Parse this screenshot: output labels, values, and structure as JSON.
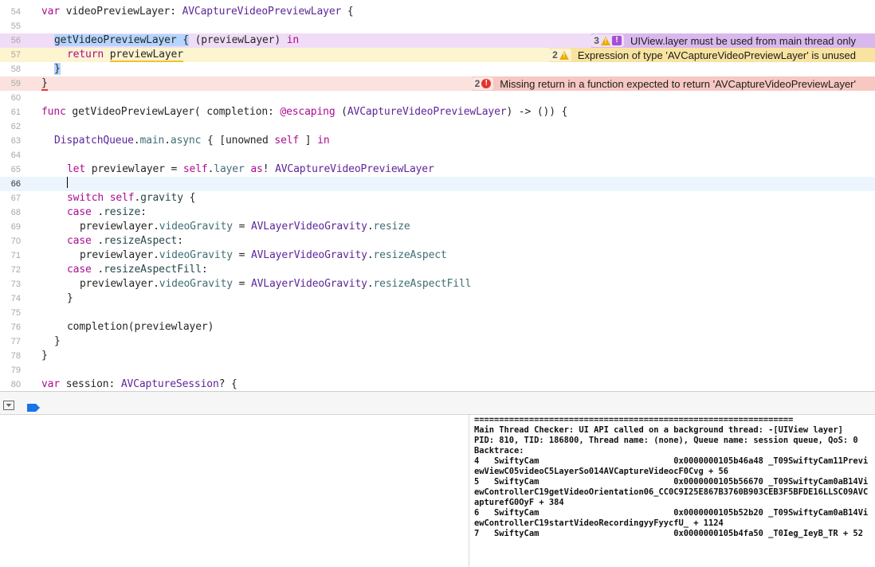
{
  "editor": {
    "lines": [
      {
        "n": "54",
        "segments": [
          [
            "kw",
            "var"
          ],
          [
            "",
            " videoPreviewLayer: "
          ],
          [
            "ty",
            "AVCaptureVideoPreviewLayer"
          ],
          [
            "",
            " {"
          ]
        ]
      },
      {
        "n": "55",
        "segments": []
      },
      {
        "n": "56",
        "segments": [
          [
            "sel",
            "getVideoPreviewLayer {"
          ],
          [
            "",
            " (previewLayer) "
          ],
          [
            "kw",
            "in"
          ]
        ]
      },
      {
        "n": "57",
        "segments": [
          [
            "kw",
            "return"
          ],
          [
            "",
            " "
          ],
          [
            "uw",
            "previewLayer"
          ]
        ]
      },
      {
        "n": "58",
        "segments": [
          [
            "sel",
            "}"
          ]
        ]
      },
      {
        "n": "59",
        "segments": [
          [
            "err",
            "}"
          ]
        ]
      },
      {
        "n": "60",
        "segments": []
      },
      {
        "n": "61",
        "segments": [
          [
            "kw",
            "func"
          ],
          [
            "",
            " getVideoPreviewLayer( completion: "
          ],
          [
            "at",
            "@escaping"
          ],
          [
            "",
            " ("
          ],
          [
            "ty",
            "AVCaptureVideoPreviewLayer"
          ],
          [
            "",
            ") -> ()) {"
          ]
        ]
      },
      {
        "n": "62",
        "segments": []
      },
      {
        "n": "63",
        "segments": [
          [
            "ty",
            "DispatchQueue"
          ],
          [
            "",
            "."
          ],
          [
            "pr",
            "main"
          ],
          [
            "",
            "."
          ],
          [
            "pr",
            "async"
          ],
          [
            "",
            " { [unowned "
          ],
          [
            "kw",
            "self"
          ],
          [
            "",
            " ] "
          ],
          [
            "kw",
            "in"
          ]
        ]
      },
      {
        "n": "64",
        "segments": []
      },
      {
        "n": "65",
        "segments": [
          [
            "kw",
            "let"
          ],
          [
            "",
            " previewlayer = "
          ],
          [
            "kw",
            "self"
          ],
          [
            "",
            "."
          ],
          [
            "pr",
            "layer"
          ],
          [
            "",
            " "
          ],
          [
            "kw",
            "as"
          ],
          [
            "",
            "! "
          ],
          [
            "ty",
            "AVCaptureVideoPreviewLayer"
          ]
        ]
      },
      {
        "n": "66",
        "segments": []
      },
      {
        "n": "67",
        "segments": [
          [
            "kw",
            "switch"
          ],
          [
            "",
            " "
          ],
          [
            "kw",
            "self"
          ],
          [
            "",
            "."
          ],
          [
            "pl",
            "gravity"
          ],
          [
            "",
            " {"
          ]
        ]
      },
      {
        "n": "68",
        "segments": [
          [
            "kw",
            "case"
          ],
          [
            "",
            " ."
          ],
          [
            "pl",
            "resize"
          ],
          [
            "",
            ":"
          ]
        ]
      },
      {
        "n": "69",
        "segments": [
          [
            "",
            "previewlayer."
          ],
          [
            "pr",
            "videoGravity"
          ],
          [
            "",
            " = "
          ],
          [
            "ty",
            "AVLayerVideoGravity"
          ],
          [
            "",
            "."
          ],
          [
            "pr",
            "resize"
          ]
        ]
      },
      {
        "n": "70",
        "segments": [
          [
            "kw",
            "case"
          ],
          [
            "",
            " ."
          ],
          [
            "pl",
            "resizeAspect"
          ],
          [
            "",
            ":"
          ]
        ]
      },
      {
        "n": "71",
        "segments": [
          [
            "",
            "previewlayer."
          ],
          [
            "pr",
            "videoGravity"
          ],
          [
            "",
            " = "
          ],
          [
            "ty",
            "AVLayerVideoGravity"
          ],
          [
            "",
            "."
          ],
          [
            "pr",
            "resizeAspect"
          ]
        ]
      },
      {
        "n": "72",
        "segments": [
          [
            "kw",
            "case"
          ],
          [
            "",
            " ."
          ],
          [
            "pl",
            "resizeAspectFill"
          ],
          [
            "",
            ":"
          ]
        ]
      },
      {
        "n": "73",
        "segments": [
          [
            "",
            "previewlayer."
          ],
          [
            "pr",
            "videoGravity"
          ],
          [
            "",
            " = "
          ],
          [
            "ty",
            "AVLayerVideoGravity"
          ],
          [
            "",
            "."
          ],
          [
            "pr",
            "resizeAspectFill"
          ]
        ]
      },
      {
        "n": "74",
        "segments": [
          [
            "",
            "}"
          ]
        ]
      },
      {
        "n": "75",
        "segments": []
      },
      {
        "n": "76",
        "segments": [
          [
            "",
            "completion(previewlayer)"
          ]
        ]
      },
      {
        "n": "77",
        "segments": [
          [
            "",
            "}"
          ]
        ]
      },
      {
        "n": "78",
        "segments": [
          [
            "",
            "}"
          ]
        ]
      },
      {
        "n": "79",
        "segments": []
      },
      {
        "n": "80",
        "segments": [
          [
            "kw",
            "var"
          ],
          [
            "",
            " session: "
          ],
          [
            "ty",
            "AVCaptureSession"
          ],
          [
            "",
            "? {"
          ]
        ]
      }
    ],
    "issues": {
      "main_thread": {
        "count": "3",
        "text": "UIView.layer must be used from main thread only"
      },
      "unused": {
        "count": "2",
        "text": "Expression of type 'AVCaptureVideoPreviewLayer' is unused"
      },
      "missing_return": {
        "count": "2",
        "text": "Missing return in a function expected to return 'AVCaptureVideoPreviewLayer'"
      }
    }
  },
  "console": {
    "text": "================================================================\nMain Thread Checker: UI API called on a background thread: -[UIView layer]\nPID: 810, TID: 186800, Thread name: (none), Queue name: session queue, QoS: 0\nBacktrace:\n4   SwiftyCam                           0x0000000105b46a48 _T09SwiftyCam11PreviewViewC05videoC5LayerSo014AVCaptureVideocF0Cvg + 56\n5   SwiftyCam                           0x0000000105b56670 _T09SwiftyCam0aB14ViewControllerC19getVideoOrientation06_CC0C9I25E867B3760B903CEB3F5BFDE16LLSC09AVCapturefG0OyF + 384\n6   SwiftyCam                           0x0000000105b52b20 _T09SwiftyCam0aB14ViewControllerC19startVideoRecordingyyFyycfU_ + 1124\n7   SwiftyCam                           0x0000000105b4fa50 _T0Ieg_IeyB_TR + 52"
  },
  "colors": {
    "keyword": "#aa0d91",
    "type": "#5c2699",
    "error": "#e4332b",
    "warning": "#e8ad00",
    "runtime": "#a64fd6"
  }
}
